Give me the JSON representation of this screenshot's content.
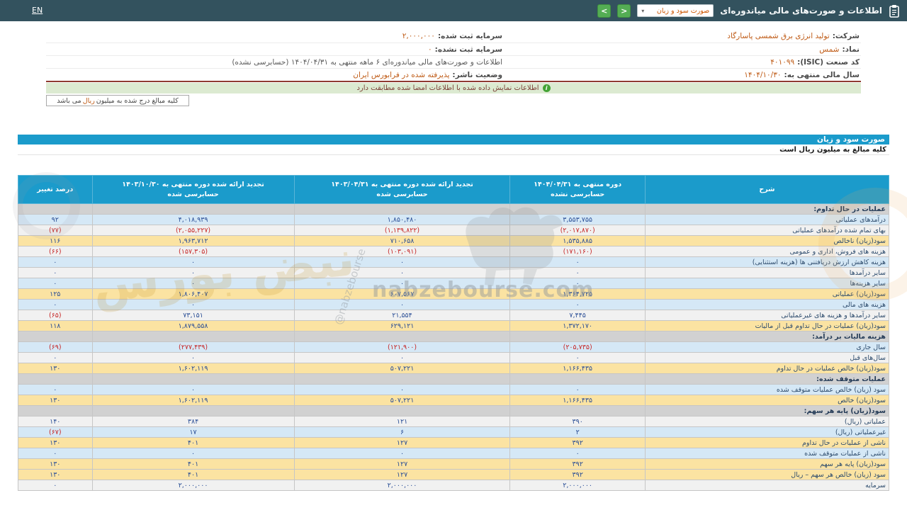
{
  "header": {
    "en_label": "EN",
    "title": "اطلاعات و صورت‌های مالی میاندوره‌ای",
    "report_select_value": "صورت سود و زیان",
    "select_caret": "▾",
    "next_symbol": ">",
    "prev_symbol": "<"
  },
  "info": {
    "rows": [
      {
        "right_label": "شرکت:",
        "right_value": "تولید انرژی برق شمسی پاسارگاد",
        "left_label": "سرمایه ثبت شده:",
        "left_value": "۲,۰۰۰,۰۰۰"
      },
      {
        "right_label": "نماد:",
        "right_value": "شمس",
        "left_label": "سرمایه ثبت نشده:",
        "left_value": "۰"
      },
      {
        "right_label": "کد صنعت (ISIC):",
        "right_value": "۴۰۱۰۹۹",
        "left_label": "",
        "left_value": "اطلاعات و صورت‌های مالی میاندوره‌ای ۶ ماهه منتهی به ۱۴۰۴/۰۴/۳۱ (حسابرسی نشده)"
      },
      {
        "right_label": "سال مالی منتهی به:",
        "right_value": "۱۴۰۴/۱۰/۳۰",
        "left_label": "وضعیت ناشر:",
        "left_value": "پذیرفته شده در فرابورس ایران"
      }
    ]
  },
  "notice": {
    "icon": "i",
    "text": "اطلاعات نمایش داده شده با اطلاعات امضا شده مطابقت دارد"
  },
  "currency_note": {
    "pre": "کلیه مبالغ درج شده به میلیون",
    "rial": "ریال",
    "post": "می باشد"
  },
  "statement": {
    "title": "صورت سود و زیان",
    "subtitle": "کلیه مبالغ به میلیون ریال است",
    "columns": [
      {
        "l1": "شرح",
        "l2": ""
      },
      {
        "l1": "دوره منتهی به ۱۴۰۴/۰۴/۳۱",
        "l2": "حسابرسی نشده"
      },
      {
        "l1": "تجدید ارائه شده دوره منتهی به ۱۴۰۳/۰۴/۳۱",
        "l2": "حسابرسی شده"
      },
      {
        "l1": "تجدید ارائه شده دوره منتهی به ۱۴۰۳/۱۰/۳۰",
        "l2": "حسابرسی شده"
      },
      {
        "l1": "درصد تغییر",
        "l2": ""
      }
    ],
    "rows": [
      {
        "type": "section",
        "label": "عملیات در حال تداوم:",
        "v1": "",
        "v2": "",
        "v3": "",
        "pct": ""
      },
      {
        "type": "blue",
        "label": "درآمدهای عملیاتی",
        "v1": "۳,۵۵۳,۷۵۵",
        "v2": "۱,۸۵۰,۴۸۰",
        "v3": "۴,۰۱۸,۹۳۹",
        "pct": "۹۲"
      },
      {
        "type": "plain",
        "label": "بهاى تمام شده درآمدهای عملیاتی",
        "v1": "(۲,۰۱۷,۸۷۰)",
        "v2": "(۱,۱۳۹,۸۲۲)",
        "v3": "(۲,۰۵۵,۲۲۷)",
        "pct": "(۷۷)"
      },
      {
        "type": "highlight",
        "label": "سود(زیان) ناخالص",
        "v1": "۱,۵۳۵,۸۸۵",
        "v2": "۷۱۰,۶۵۸",
        "v3": "۱,۹۶۳,۷۱۲",
        "pct": "۱۱۶"
      },
      {
        "type": "plain",
        "label": "هزینه‌ های فروش، اداری و عمومی",
        "v1": "(۱۷۱,۱۶۰)",
        "v2": "(۱۰۳,۰۹۱)",
        "v3": "(۱۵۷,۳۰۵)",
        "pct": "(۶۶)"
      },
      {
        "type": "blue",
        "label": "هزینه کاهش ارزش دریافتنی‌ ها (هزینه استثنایی)",
        "v1": "۰",
        "v2": "۰",
        "v3": "۰",
        "pct": "۰"
      },
      {
        "type": "plain",
        "label": "سایر درآمدها",
        "v1": "۰",
        "v2": "۰",
        "v3": "۰",
        "pct": "۰"
      },
      {
        "type": "blue",
        "label": "سایر هزینه‌ها",
        "v1": "۰",
        "v2": "۰",
        "v3": "۰",
        "pct": "۰"
      },
      {
        "type": "highlight",
        "label": "سود(زیان) عملیاتی",
        "v1": "۱,۳۶۴,۷۲۵",
        "v2": "۶۰۷,۵۶۷",
        "v3": "۱,۸۰۶,۴۰۷",
        "pct": "۱۲۵"
      },
      {
        "type": "blue",
        "label": "هزینه‌ های مالی",
        "v1": "۰",
        "v2": "۰",
        "v3": "۰",
        "pct": "۰"
      },
      {
        "type": "plain",
        "label": "سایر درآمدها و هزینه های غیرعملیاتی",
        "v1": "۷,۴۴۵",
        "v2": "۲۱,۵۵۴",
        "v3": "۷۳,۱۵۱",
        "pct": "(۶۵)"
      },
      {
        "type": "highlight",
        "label": "سود(زیان) عملیات در حال تداوم قبل از مالیات",
        "v1": "۱,۳۷۲,۱۷۰",
        "v2": "۶۲۹,۱۲۱",
        "v3": "۱,۸۷۹,۵۵۸",
        "pct": "۱۱۸"
      },
      {
        "type": "section",
        "label": "هزینه مالیات بر درآمد:",
        "v1": "",
        "v2": "",
        "v3": "",
        "pct": ""
      },
      {
        "type": "blue",
        "label": "سال جاری",
        "v1": "(۲۰۵,۷۳۵)",
        "v2": "(۱۲۱,۹۰۰)",
        "v3": "(۲۷۷,۴۳۹)",
        "pct": "(۶۹)"
      },
      {
        "type": "plain",
        "label": "سال‌های قبل",
        "v1": "۰",
        "v2": "۰",
        "v3": "۰",
        "pct": "۰"
      },
      {
        "type": "highlight",
        "label": "سود(زیان) خالص عملیات در حال تداوم",
        "v1": "۱,۱۶۶,۴۳۵",
        "v2": "۵۰۷,۲۲۱",
        "v3": "۱,۶۰۲,۱۱۹",
        "pct": "۱۳۰"
      },
      {
        "type": "section",
        "label": "عملیات متوقف شده:",
        "v1": "",
        "v2": "",
        "v3": "",
        "pct": ""
      },
      {
        "type": "blue",
        "label": "سود (زیان) خالص عملیات متوقف شده",
        "v1": "۰",
        "v2": "۰",
        "v3": "۰",
        "pct": "۰"
      },
      {
        "type": "highlight",
        "label": "سود(زیان) خالص",
        "v1": "۱,۱۶۶,۴۳۵",
        "v2": "۵۰۷,۲۲۱",
        "v3": "۱,۶۰۲,۱۱۹",
        "pct": "۱۳۰"
      },
      {
        "type": "section",
        "label": "سود(زیان) پایه هر سهم:",
        "v1": "",
        "v2": "",
        "v3": "",
        "pct": ""
      },
      {
        "type": "plain",
        "label": "عملیاتی (ریال)",
        "v1": "۳۹۰",
        "v2": "۱۲۱",
        "v3": "۳۸۴",
        "pct": "۱۴۰"
      },
      {
        "type": "blue",
        "label": "غیرعملیاتی (ریال)",
        "v1": "۲",
        "v2": "۶",
        "v3": "۱۷",
        "pct": "(۶۷)"
      },
      {
        "type": "highlight",
        "label": "ناشی از عملیات در حال تداوم",
        "v1": "۳۹۲",
        "v2": "۱۲۷",
        "v3": "۴۰۱",
        "pct": "۱۳۰"
      },
      {
        "type": "blue",
        "label": "ناشی از عملیات متوقف شده",
        "v1": "۰",
        "v2": "۰",
        "v3": "۰",
        "pct": "۰"
      },
      {
        "type": "highlight",
        "label": "سود(زیان) پایه هر سهم",
        "v1": "۳۹۲",
        "v2": "۱۲۷",
        "v3": "۴۰۱",
        "pct": "۱۳۰"
      },
      {
        "type": "highlight",
        "label": "سود (زیان) خالص هر سهم – ریال",
        "v1": "۳۹۲",
        "v2": "۱۲۷",
        "v3": "۴۰۱",
        "pct": "۱۳۰"
      },
      {
        "type": "plain",
        "label": "سرمایه",
        "v1": "۲,۰۰۰,۰۰۰",
        "v2": "۲,۰۰۰,۰۰۰",
        "v3": "۲,۰۰۰,۰۰۰",
        "pct": "۰"
      }
    ]
  },
  "watermark": {
    "domain": "nabzebourse.com",
    "handle": "@nabzebourse",
    "farsi": "نبض بورس"
  },
  "colors": {
    "topbar": "#33525e",
    "accent_blue": "#1b9bcb",
    "highlight_row": "#fbe3a2",
    "blue_row": "#d5e8f6",
    "negative": "#c62828",
    "positive": "#2a4e96",
    "button_green": "#54ad54"
  }
}
